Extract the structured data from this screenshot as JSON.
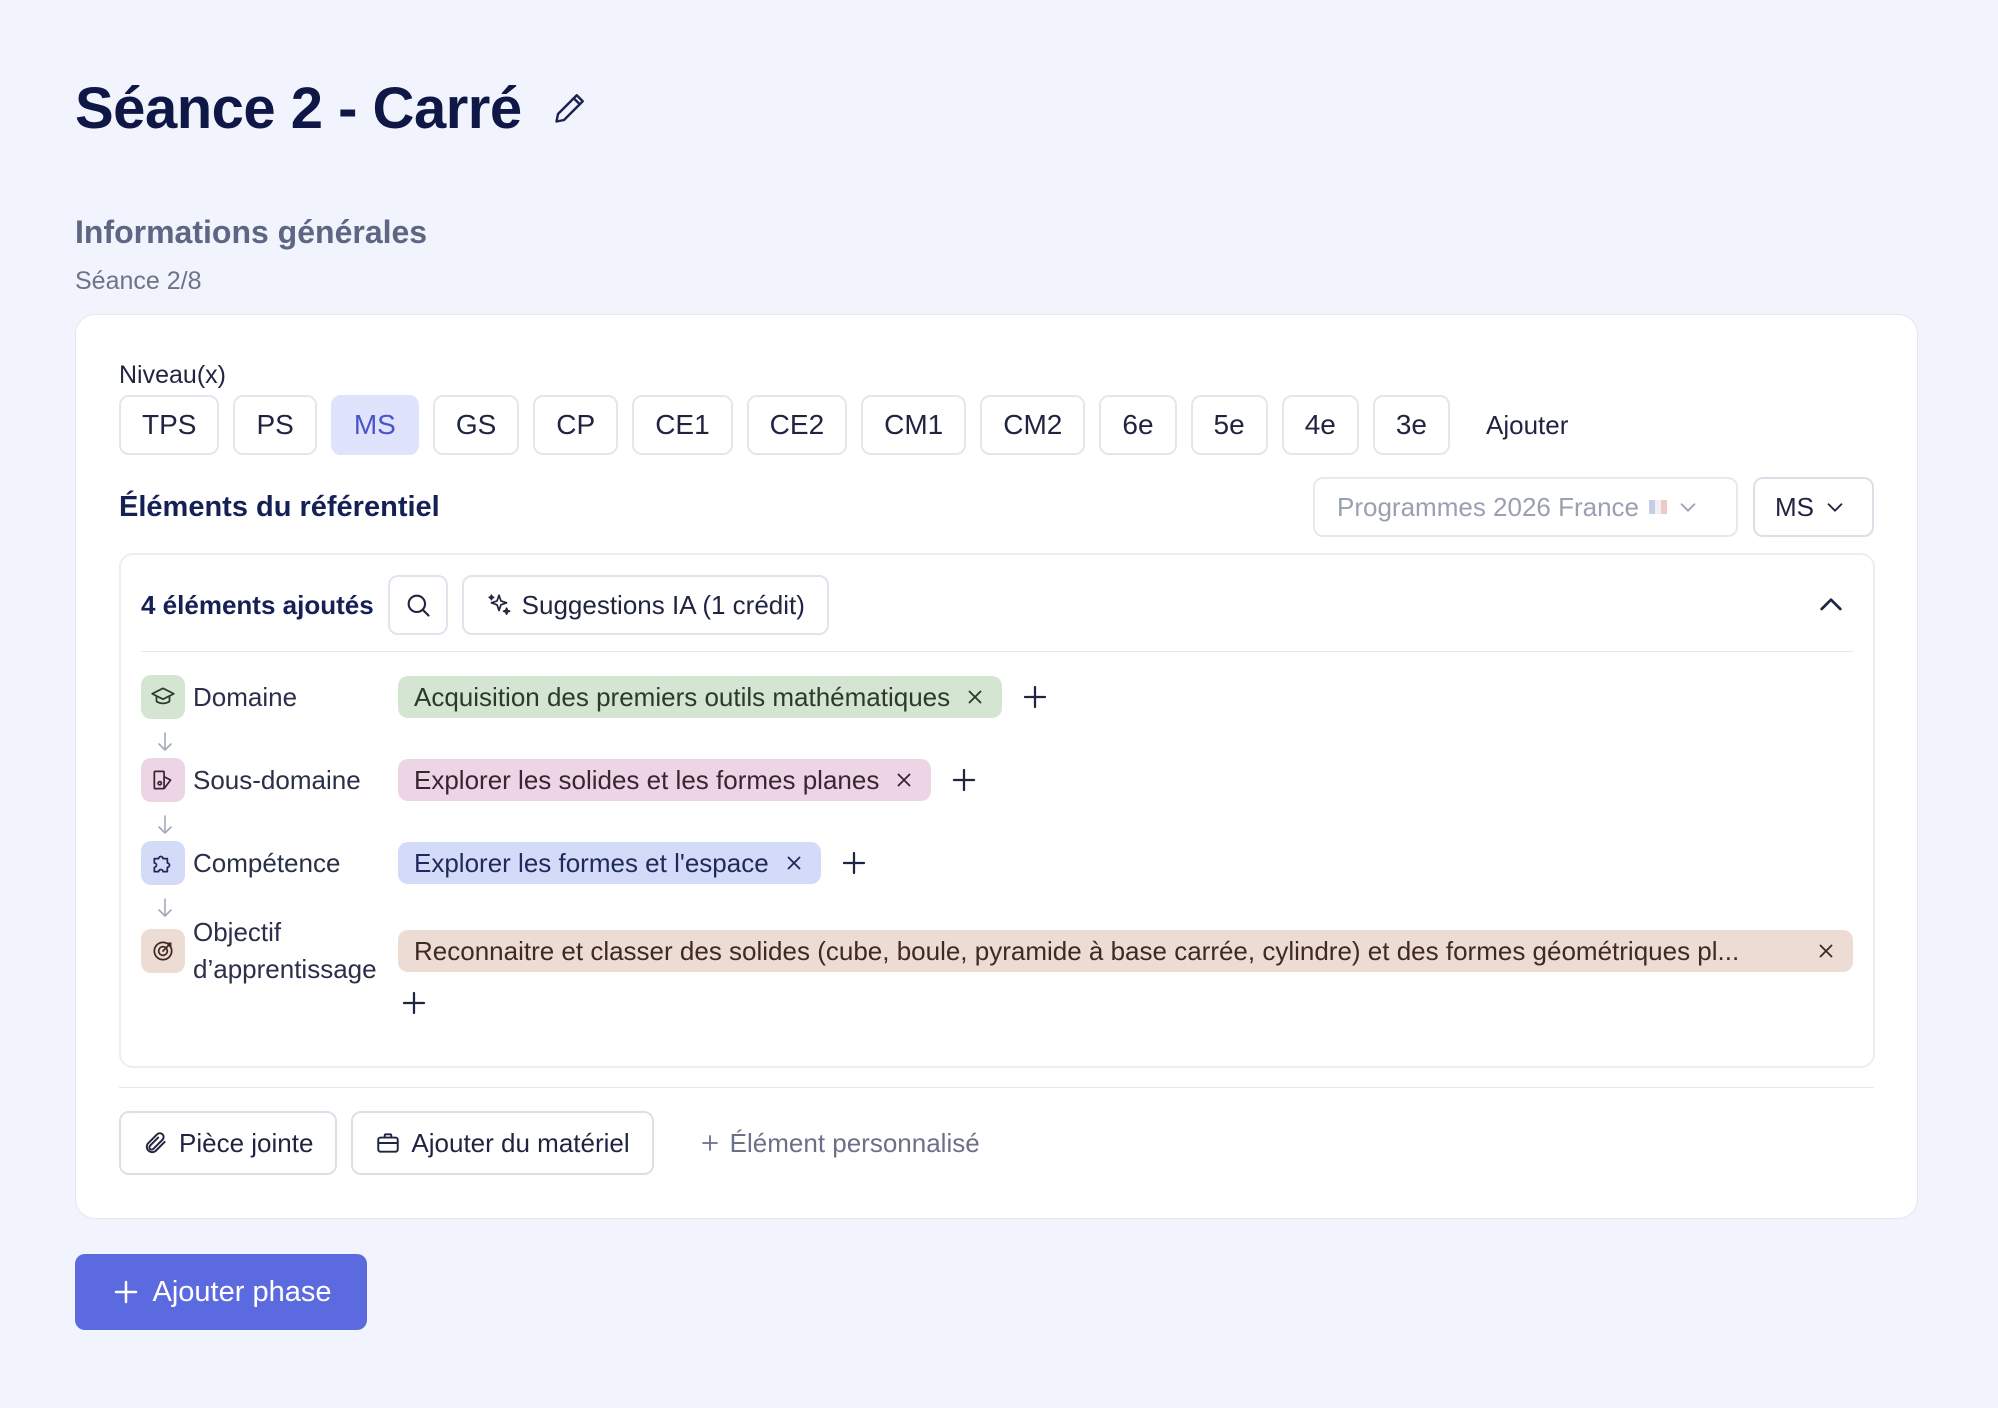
{
  "title": "Séance 2 - Carré",
  "general": {
    "title": "Informations générales",
    "subtitle": "Séance 2/8"
  },
  "niveaux": {
    "label": "Niveau(x)",
    "levels": [
      "TPS",
      "PS",
      "MS",
      "GS",
      "CP",
      "CE1",
      "CE2",
      "CM1",
      "CM2",
      "6e",
      "5e",
      "4e",
      "3e"
    ],
    "selected": "MS",
    "add_label": "Ajouter"
  },
  "referentiel": {
    "title": "Éléments du référentiel",
    "program_select": "Programmes 2026 France",
    "level_select": "MS",
    "count_label": "4 éléments ajoutés",
    "suggestions_label": "Suggestions IA (1 crédit)",
    "rows": [
      {
        "label": "Domaine",
        "tag": "Acquisition des premiers outils mathématiques",
        "icon": "graduation-cap-icon",
        "color": "#d4e6d1",
        "text_color": "#2b3a2b"
      },
      {
        "label": "Sous-domaine",
        "tag": "Explorer les solides et les formes planes",
        "icon": "shapes-icon",
        "color": "#ecd5e4",
        "text_color": "#3a2633"
      },
      {
        "label": "Compétence",
        "tag": "Explorer les formes et l'espace",
        "icon": "puzzle-icon",
        "color": "#d3dbf8",
        "text_color": "#1e2a5c"
      },
      {
        "label": "Objectif d’apprentissage",
        "tag": "Reconnaitre et classer des solides (cube, boule, pyramide à base carrée, cylindre) et des formes géométriques pl...",
        "icon": "target-icon",
        "color": "#ecdcd4",
        "text_color": "#3f2a22"
      }
    ]
  },
  "actions": {
    "attachment": "Pièce jointe",
    "material": "Ajouter du matériel",
    "custom": "Élément personnalisé"
  },
  "add_phase": "Ajouter phase"
}
